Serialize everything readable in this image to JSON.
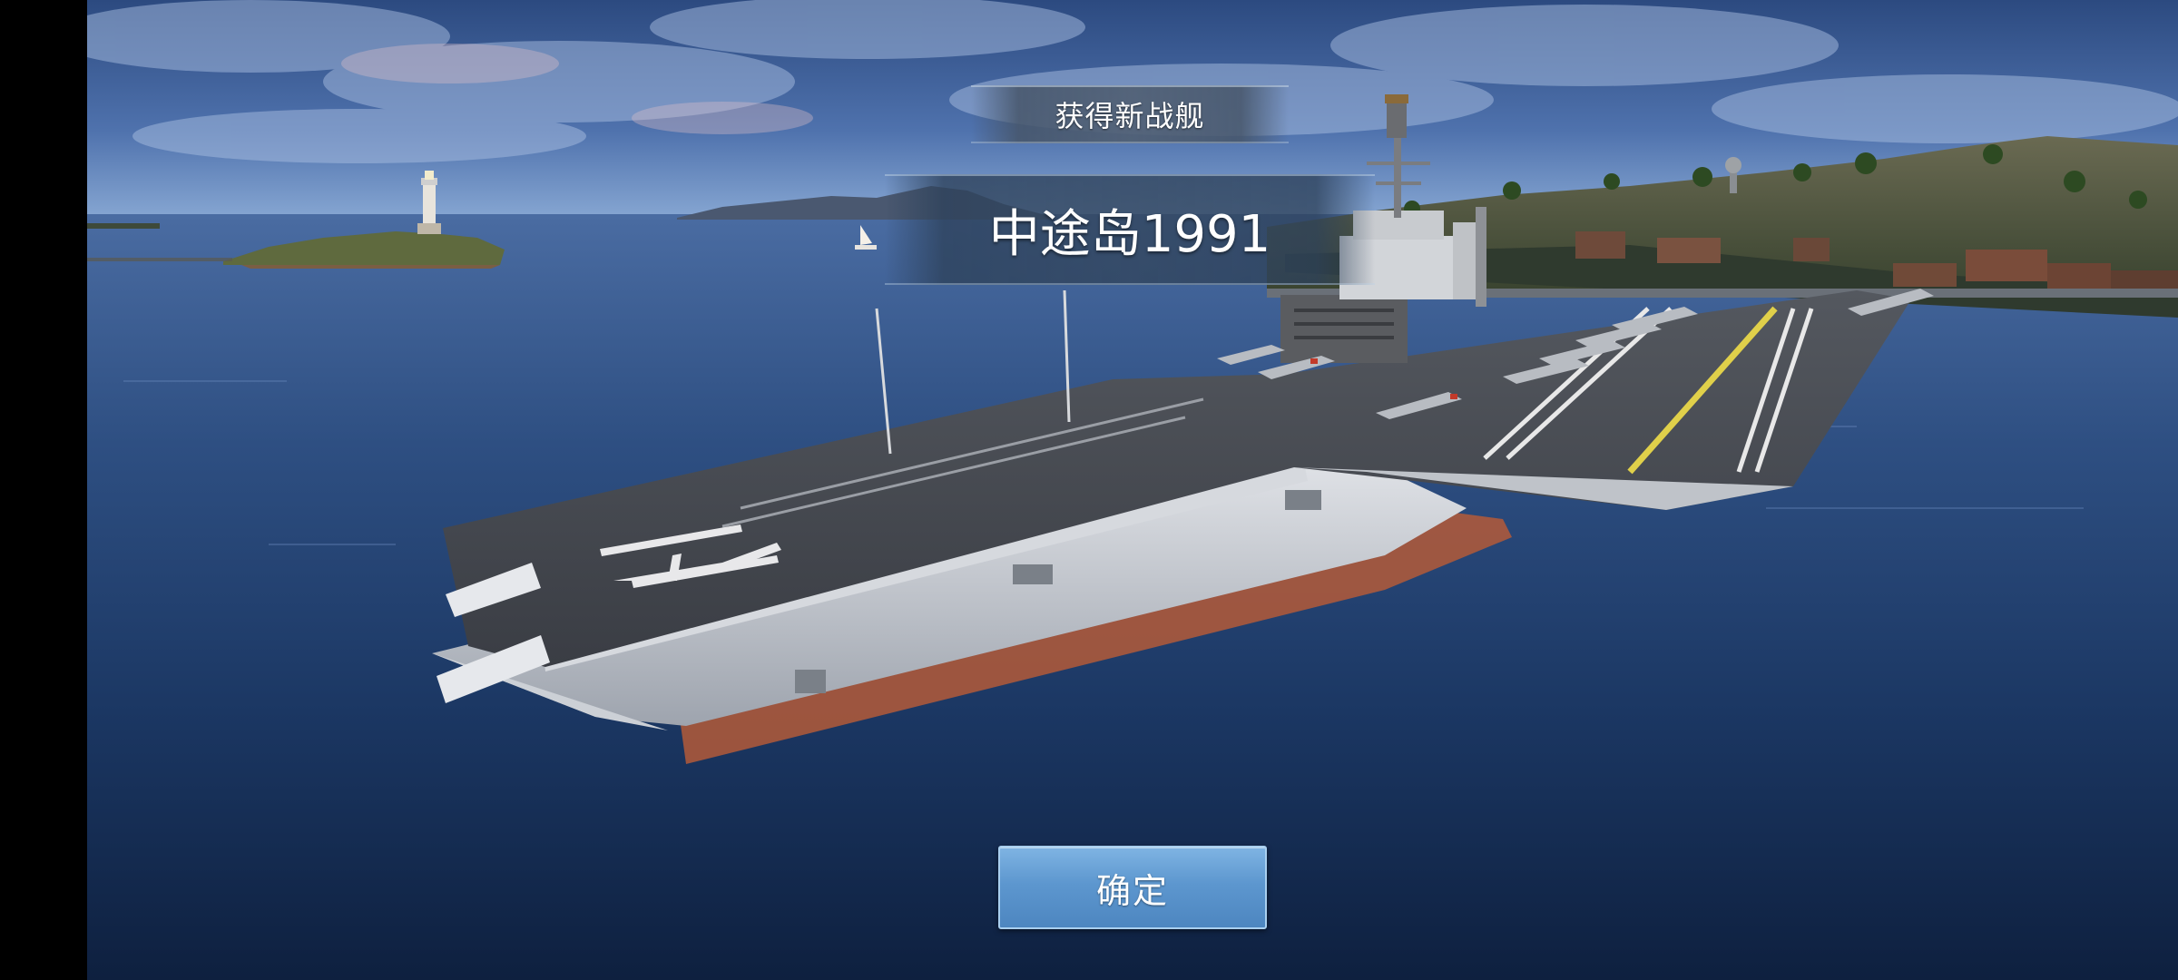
{
  "reward_popup": {
    "title": "获得新战舰",
    "ship_name": "中途岛1991",
    "confirm_label": "确定"
  },
  "colors": {
    "sky_top": "#3d5f9a",
    "sky_horizon": "#7d9dcc",
    "sea_far": "#3e5f95",
    "sea_near": "#132a4c",
    "button_accent": "#5d97cf"
  },
  "icons": {
    "lighthouse": "lighthouse-icon",
    "sailboat": "sailboat-icon"
  }
}
